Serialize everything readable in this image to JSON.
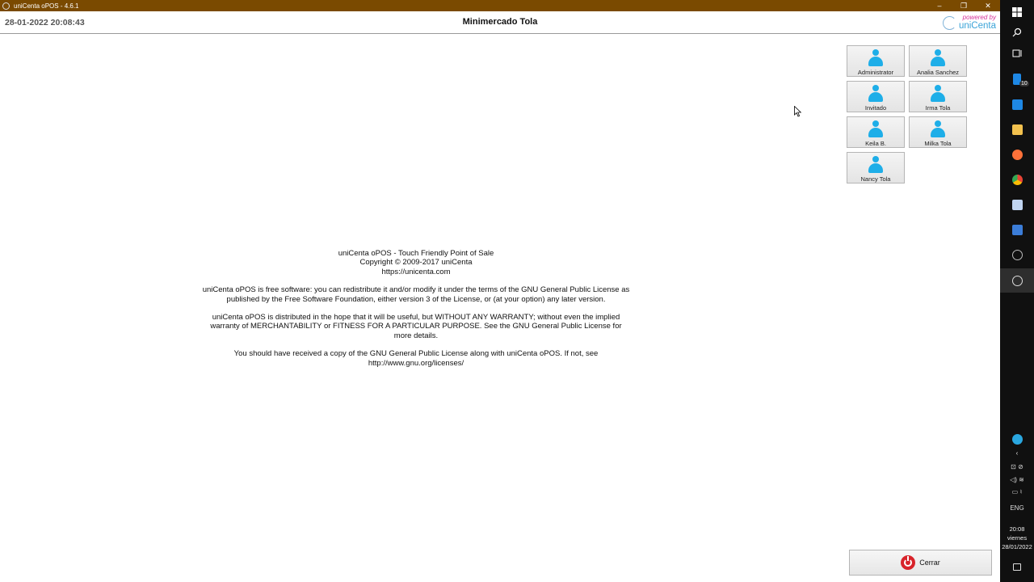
{
  "window": {
    "title": "uniCenta oPOS - 4.6.1",
    "controls": {
      "minimize": "–",
      "restore": "❐",
      "close": "✕"
    }
  },
  "header": {
    "datetime": "28-01-2022 20:08:43",
    "store_name": "Minimercado Tola",
    "logo_powered": "powered by",
    "logo_brand": "uniCenta"
  },
  "users": [
    {
      "name": "Administrator"
    },
    {
      "name": "Analia Sanchez"
    },
    {
      "name": "Invitado"
    },
    {
      "name": "Irma Tola"
    },
    {
      "name": "Keila B."
    },
    {
      "name": "Milka Tola"
    },
    {
      "name": "Nancy Tola"
    }
  ],
  "license": {
    "line1": "uniCenta oPOS - Touch Friendly Point of Sale",
    "line2": "Copyright © 2009-2017 uniCenta",
    "line3": "https://unicenta.com",
    "para1": "uniCenta oPOS is free software: you can redistribute it and/or modify it under the terms of the GNU General Public License as published by the Free Software Foundation, either version 3 of the License, or (at your option) any later version.",
    "para2": "uniCenta oPOS is distributed in the hope that it will be useful, but WITHOUT ANY WARRANTY; without even the implied warranty of MERCHANTABILITY or FITNESS FOR A PARTICULAR PURPOSE. See the GNU General Public License for more details.",
    "para3": "You should have received a copy of the GNU General Public License along with uniCenta oPOS. If not, see http://www.gnu.org/licenses/"
  },
  "close_button": {
    "label": "Cerrar"
  },
  "taskbar": {
    "badge_count": "10",
    "language": "ENG",
    "clock_time": "20:08",
    "clock_day": "viernes",
    "clock_date": "28/01/2022",
    "colors": {
      "mail": "#1e88e5",
      "files": "#f2c14e",
      "firefox": "#ff7139",
      "chrome": "#34a853",
      "store": "#c0d4f0"
    }
  }
}
